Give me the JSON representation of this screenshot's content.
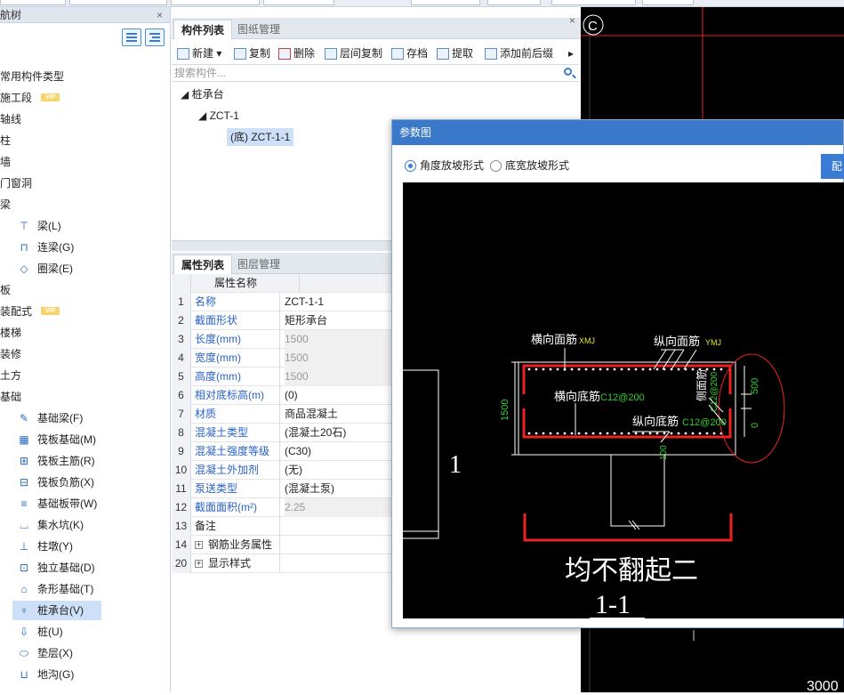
{
  "nav": {
    "title": "航树",
    "items": [
      {
        "label": "常用构件类型",
        "indent": 0
      },
      {
        "label": "施工段",
        "indent": 0,
        "vip": "VIP"
      },
      {
        "label": "轴线",
        "indent": 0
      },
      {
        "label": "柱",
        "indent": 0
      },
      {
        "label": "墙",
        "indent": 0
      },
      {
        "label": "门窗洞",
        "indent": 0
      },
      {
        "label": "梁",
        "indent": 0
      },
      {
        "label": "梁(L)",
        "indent": 1,
        "icon": "beam-icon"
      },
      {
        "label": "连梁(G)",
        "indent": 1,
        "icon": "link-beam-icon"
      },
      {
        "label": "圈梁(E)",
        "indent": 1,
        "icon": "ring-beam-icon"
      },
      {
        "label": "板",
        "indent": 0
      },
      {
        "label": "装配式",
        "indent": 0,
        "vip": "VIP"
      },
      {
        "label": "楼梯",
        "indent": 0
      },
      {
        "label": "装修",
        "indent": 0
      },
      {
        "label": "土方",
        "indent": 0
      },
      {
        "label": "基础",
        "indent": 0
      },
      {
        "label": "基础梁(F)",
        "indent": 1,
        "icon": "foundation-beam-icon"
      },
      {
        "label": "筏板基础(M)",
        "indent": 1,
        "icon": "raft-foundation-icon"
      },
      {
        "label": "筏板主筋(R)",
        "indent": 1,
        "icon": "raft-main-rebar-icon"
      },
      {
        "label": "筏板负筋(X)",
        "indent": 1,
        "icon": "raft-neg-rebar-icon"
      },
      {
        "label": "基础板带(W)",
        "indent": 1,
        "icon": "foundation-strip-icon"
      },
      {
        "label": "集水坑(K)",
        "indent": 1,
        "icon": "sump-pit-icon"
      },
      {
        "label": "柱墩(Y)",
        "indent": 1,
        "icon": "column-pier-icon"
      },
      {
        "label": "独立基础(D)",
        "indent": 1,
        "icon": "isolated-footing-icon"
      },
      {
        "label": "条形基础(T)",
        "indent": 1,
        "icon": "strip-footing-icon"
      },
      {
        "label": "桩承台(V)",
        "indent": 1,
        "icon": "pile-cap-icon",
        "selected": true
      },
      {
        "label": "桩(U)",
        "indent": 1,
        "icon": "pile-icon"
      },
      {
        "label": "垫层(X)",
        "indent": 1,
        "icon": "cushion-icon"
      },
      {
        "label": "地沟(G)",
        "indent": 1,
        "icon": "trench-icon"
      }
    ]
  },
  "components": {
    "tabs": [
      "构件列表",
      "图纸管理"
    ],
    "toolbar": [
      "新建",
      "复制",
      "删除",
      "层间复制",
      "存档",
      "提取",
      "添加前后缀"
    ],
    "search_placeholder": "搜索构件...",
    "tree": [
      {
        "label": "桩承台",
        "level": 0
      },
      {
        "label": "ZCT-1",
        "level": 1
      },
      {
        "label": "(底) ZCT-1-1",
        "level": 2,
        "selected": true
      }
    ]
  },
  "properties": {
    "tabs": [
      "属性列表",
      "图层管理"
    ],
    "header": "属性名称",
    "rows": [
      {
        "n": "1",
        "k": "名称",
        "v": "ZCT-1-1"
      },
      {
        "n": "2",
        "k": "截面形状",
        "v": "矩形承台"
      },
      {
        "n": "3",
        "k": "长度(mm)",
        "v": "1500",
        "grey": true
      },
      {
        "n": "4",
        "k": "宽度(mm)",
        "v": "1500",
        "grey": true
      },
      {
        "n": "5",
        "k": "高度(mm)",
        "v": "1500",
        "grey": true
      },
      {
        "n": "6",
        "k": "相对底标高(m)",
        "v": "(0)"
      },
      {
        "n": "7",
        "k": "材质",
        "v": "商品混凝土"
      },
      {
        "n": "8",
        "k": "混凝土类型",
        "v": "(混凝土20石)"
      },
      {
        "n": "9",
        "k": "混凝土强度等级",
        "v": "(C30)"
      },
      {
        "n": "10",
        "k": "混凝土外加剂",
        "v": "(无)"
      },
      {
        "n": "11",
        "k": "泵送类型",
        "v": "(混凝土泵)"
      },
      {
        "n": "12",
        "k": "截面面积(m²)",
        "v": "2.25",
        "grey": true
      },
      {
        "n": "13",
        "k": "备注",
        "v": "",
        "black": true
      },
      {
        "n": "14",
        "k": "钢筋业务属性",
        "v": "",
        "black": true,
        "plus": true
      },
      {
        "n": "20",
        "k": "显示样式",
        "v": "",
        "black": true,
        "plus": true
      }
    ]
  },
  "dialog": {
    "title": "参数图",
    "radio_angle": "角度放坡形式",
    "radio_width": "底宽放坡形式",
    "config_btn": "配",
    "diagram": {
      "top_bar_h": "横向面筋",
      "top_bar_h_val": "XMJ",
      "top_bar_v": "纵向面筋",
      "top_bar_v_val": "YMJ",
      "bot_bar_h": "横向底筋",
      "bot_bar_h_val": "C12@200",
      "bot_bar_v": "纵向底筋",
      "bot_bar_v_val": "C12@200",
      "side_bar": "侧面筋",
      "side_bar_val": "C12@200",
      "dim_1500": "1500",
      "dim_500": "500",
      "dim_0": "0",
      "dim_100": "100",
      "label_1": "1",
      "caption": "均不翻起二",
      "section": "1-1"
    }
  },
  "canvas": {
    "axis_label": "C",
    "dim_3000": "3000"
  },
  "colors": {
    "accent": "#3a7bd5",
    "blue_text": "#2a62c8",
    "dlg_title": "#3a78c9"
  }
}
